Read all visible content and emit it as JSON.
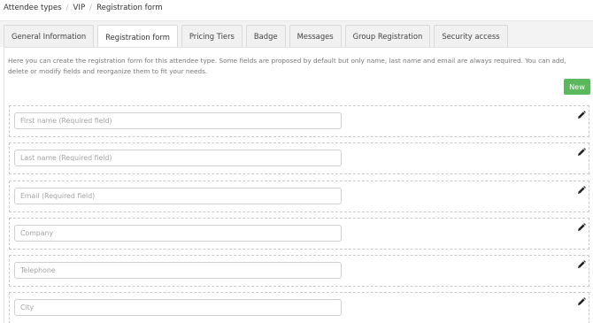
{
  "breadcrumb": {
    "items": [
      "Attendee types",
      "VIP",
      "Registration form"
    ],
    "separator": "/"
  },
  "tabs": [
    {
      "label": "General Information",
      "active": false
    },
    {
      "label": "Registration form",
      "active": true
    },
    {
      "label": "Pricing Tiers",
      "active": false
    },
    {
      "label": "Badge",
      "active": false
    },
    {
      "label": "Messages",
      "active": false
    },
    {
      "label": "Group Registration",
      "active": false
    },
    {
      "label": "Security access",
      "active": false
    }
  ],
  "description": "Here you can create the registration form for this attendee type. Some fields are proposed by default but only name, last name and email are always required. You can add, delete or modify fields and reorganize them to fit your needs.",
  "new_button": {
    "label": "New",
    "color": "#5cb85c"
  },
  "fields": [
    {
      "placeholder": "First name (Required field)",
      "edit_icon": "pencil-icon"
    },
    {
      "placeholder": "Last name (Required field)",
      "edit_icon": "pencil-icon"
    },
    {
      "placeholder": "Email (Required field)",
      "edit_icon": "pencil-icon"
    },
    {
      "placeholder": "Company",
      "edit_icon": "pencil-icon"
    },
    {
      "placeholder": "Telephone",
      "edit_icon": "pencil-icon"
    },
    {
      "placeholder": "City",
      "edit_icon": "pencil-icon"
    }
  ]
}
